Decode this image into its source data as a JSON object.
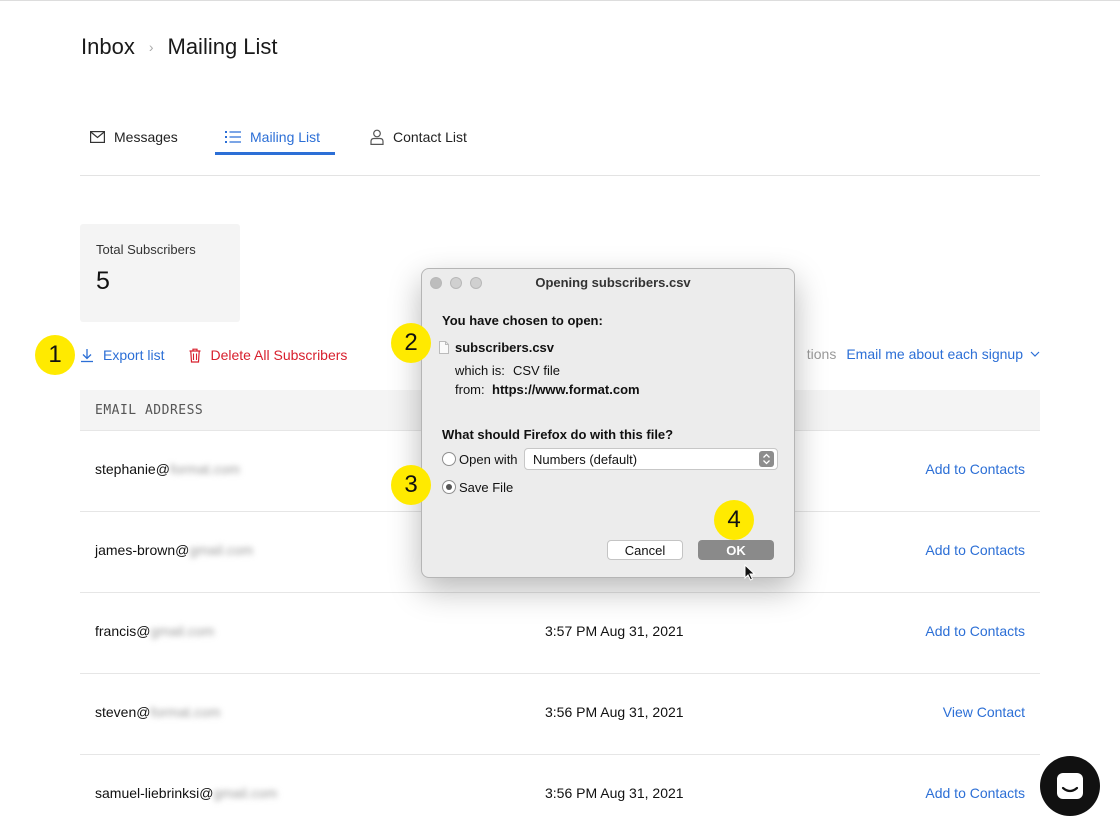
{
  "breadcrumb": {
    "root": "Inbox",
    "current": "Mailing List"
  },
  "tabs": [
    {
      "label": "Messages",
      "icon": "envelope-icon"
    },
    {
      "label": "Mailing List",
      "icon": "list-icon",
      "active": true
    },
    {
      "label": "Contact List",
      "icon": "person-icon"
    }
  ],
  "stats": {
    "total_label": "Total Subscribers",
    "total_value": "5"
  },
  "actions": {
    "export": "Export list",
    "delete": "Delete All Subscribers"
  },
  "right_actions": {
    "partial_text": "tions",
    "email_pref": "Email me about each signup"
  },
  "table": {
    "header_email": "EMAIL ADDRESS",
    "rows": [
      {
        "email_user": "stephanie@",
        "email_domain": "format.com",
        "date": "",
        "action": "Add to Contacts"
      },
      {
        "email_user": "james-brown@",
        "email_domain": "gmail.com",
        "date": "",
        "action": "Add to Contacts"
      },
      {
        "email_user": "francis@",
        "email_domain": "gmail.com",
        "date": "3:57 PM Aug 31, 2021",
        "action": "Add to Contacts"
      },
      {
        "email_user": "steven@",
        "email_domain": "format.com",
        "date": "3:56 PM Aug 31, 2021",
        "action": "View Contact"
      },
      {
        "email_user": "samuel-liebrinksi@",
        "email_domain": "gmail.com",
        "date": "3:56 PM Aug 31, 2021",
        "action": "Add to Contacts"
      }
    ]
  },
  "dialog": {
    "title": "Opening subscribers.csv",
    "chosen_label": "You have chosen to open:",
    "filename": "subscribers.csv",
    "which_is_label": "which is:",
    "which_is_value": "CSV file",
    "from_label": "from:",
    "from_value": "https://www.format.com",
    "question": "What should Firefox do with this file?",
    "open_with_label": "Open with",
    "open_with_value": "Numbers (default)",
    "save_label": "Save File",
    "cancel": "Cancel",
    "ok": "OK"
  },
  "markers": [
    "1",
    "2",
    "3",
    "4"
  ],
  "colors": {
    "accent": "#2c6fd6",
    "danger": "#d8202e",
    "marker": "#ffea00"
  }
}
